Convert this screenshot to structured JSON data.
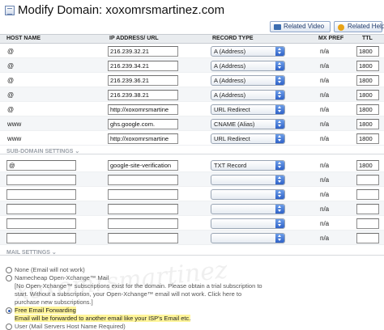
{
  "header": {
    "title": "Modify Domain: xoxomrsmartinez.com",
    "related_video": "Related Video",
    "related_help": "Related Help"
  },
  "columns": [
    "HOST NAME",
    "IP ADDRESS/ URL",
    "RECORD TYPE",
    "MX PREF",
    "TTL"
  ],
  "records": [
    {
      "host": "@",
      "ip": "216.239.32.21",
      "type": "A (Address)",
      "mx": "n/a",
      "ttl": "1800"
    },
    {
      "host": "@",
      "ip": "216.239.34.21",
      "type": "A (Address)",
      "mx": "n/a",
      "ttl": "1800"
    },
    {
      "host": "@",
      "ip": "216.239.36.21",
      "type": "A (Address)",
      "mx": "n/a",
      "ttl": "1800"
    },
    {
      "host": "@",
      "ip": "216.239.38.21",
      "type": "A (Address)",
      "mx": "n/a",
      "ttl": "1800"
    },
    {
      "host": "@",
      "ip": "http://xoxomrsmartine",
      "type": "URL Redirect",
      "mx": "n/a",
      "ttl": "1800"
    },
    {
      "host": "www",
      "ip": "ghs.google.com.",
      "type": "CNAME (Alias)",
      "mx": "n/a",
      "ttl": "1800"
    },
    {
      "host": "www",
      "ip": "http://xoxomrsmartine",
      "type": "URL Redirect",
      "mx": "n/a",
      "ttl": "1800"
    }
  ],
  "subdomain": {
    "label": "SUB-DOMAIN SETTINGS",
    "rows": [
      {
        "host": "@",
        "ip": "google-site-verification",
        "type": "TXT Record",
        "mx": "n/a",
        "ttl": "1800"
      },
      {
        "host": "",
        "ip": "",
        "type": "",
        "mx": "n/a",
        "ttl": ""
      },
      {
        "host": "",
        "ip": "",
        "type": "",
        "mx": "n/a",
        "ttl": ""
      },
      {
        "host": "",
        "ip": "",
        "type": "",
        "mx": "n/a",
        "ttl": ""
      },
      {
        "host": "",
        "ip": "",
        "type": "",
        "mx": "n/a",
        "ttl": ""
      },
      {
        "host": "",
        "ip": "",
        "type": "",
        "mx": "n/a",
        "ttl": ""
      }
    ]
  },
  "mail": {
    "label": "MAIL SETTINGS",
    "opt_none": "None (Email will not work)",
    "opt_oxc": "Namecheap Open-Xchange™ Mail",
    "oxc_note1": "[No Open-Xchange™ subscriptions exist for the domain. Please obtain a trial subscription to",
    "oxc_note2": "start. Without a subscription, your Open-Xchange™ email will not work. Click here to",
    "oxc_note3": "purchase new subscriptions.]",
    "opt_forward": "Free Email Forwarding",
    "forward_note": "Email will be forwarded to another email like your ISP's Email etc.",
    "opt_user": "User (Mail Servers Host Name Required)"
  },
  "watermark": "xoxomrsmartinez"
}
